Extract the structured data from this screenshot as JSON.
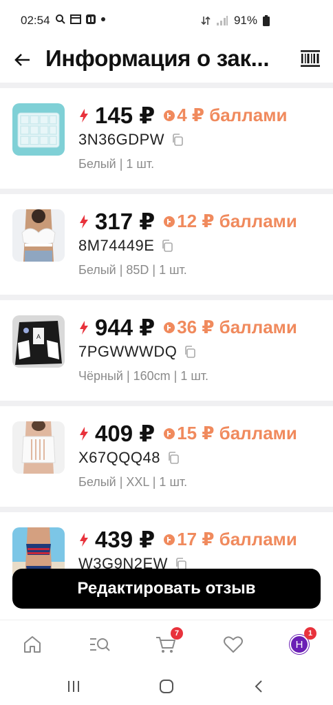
{
  "status_bar": {
    "time": "02:54",
    "battery": "91%"
  },
  "header": {
    "title": "Информация о зак..."
  },
  "items": [
    {
      "price": "145 ₽",
      "points": "4 ₽ баллами",
      "code": "3N36GDPW",
      "meta": "Белый | 1 шт.",
      "thumb": "clear-storage-box"
    },
    {
      "price": "317 ₽",
      "points": "12 ₽ баллами",
      "code": "8M74449E",
      "meta": "Белый | 85D | 1 шт.",
      "thumb": "white-lace-bra"
    },
    {
      "price": "944 ₽",
      "points": "36 ₽ баллами",
      "code": "7PGWWWDQ",
      "meta": "Чёрный | 160cm | 1 шт.",
      "thumb": "black-varsity-jacket"
    },
    {
      "price": "409 ₽",
      "points": "15 ₽ баллами",
      "code": "X67QQQ48",
      "meta": "Белый | XXL | 1 шт.",
      "thumb": "white-sports-bra"
    },
    {
      "price": "439 ₽",
      "points": "17 ₽ баллами",
      "code": "W3G9N2EW",
      "meta": "",
      "thumb": "flag-swimsuit"
    }
  ],
  "edit_button": {
    "label": "Редактировать отзыв"
  },
  "bottom_nav": {
    "cart_badge": "7",
    "profile_badge": "1",
    "avatar_letter": "Н"
  },
  "colors": {
    "accent_orange": "#f08a5d",
    "bolt_red": "#e8323c",
    "badge_red": "#e8323c",
    "avatar_purple": "#6a1fb5"
  }
}
